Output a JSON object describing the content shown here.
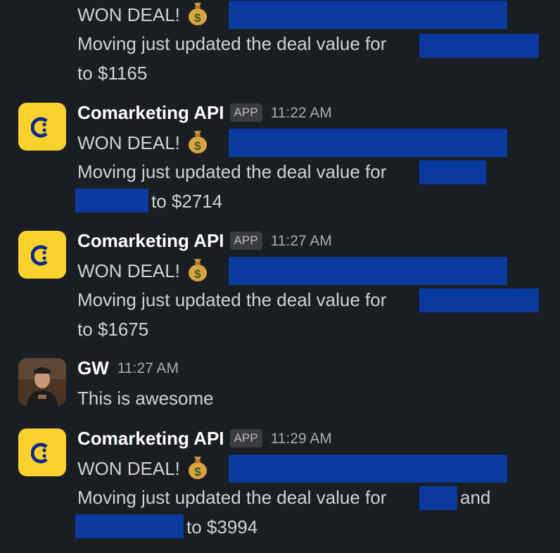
{
  "colors": {
    "background": "#1a1d21",
    "text": "#d1d2d3",
    "sender": "#ffffff",
    "timestamp": "#abacae",
    "app_avatar": "#fbd22d",
    "app_logo": "#0b2a8a",
    "redaction": "#0a3aa0"
  },
  "messages": [
    {
      "won": "WON DEAL!",
      "emoji": "money-bag",
      "update": "Moving just updated the deal value for",
      "amount": "to $1165"
    },
    {
      "sender": "Comarketing API",
      "badge": "APP",
      "time": "11:22 AM",
      "won": "WON DEAL!",
      "emoji": "money-bag",
      "update": "Moving just updated the deal value for",
      "amount": "to $2714"
    },
    {
      "sender": "Comarketing API",
      "badge": "APP",
      "time": "11:27 AM",
      "won": "WON DEAL!",
      "emoji": "money-bag",
      "update": "Moving just updated the deal value for",
      "amount": "to $1675"
    },
    {
      "sender": "GW",
      "time": "11:27 AM",
      "text": "This is awesome"
    },
    {
      "sender": "Comarketing API",
      "badge": "APP",
      "time": "11:29 AM",
      "won": "WON DEAL!",
      "emoji": "money-bag",
      "update": "Moving just updated the deal value for",
      "conjunction": "and",
      "amount": "to $3994"
    }
  ]
}
